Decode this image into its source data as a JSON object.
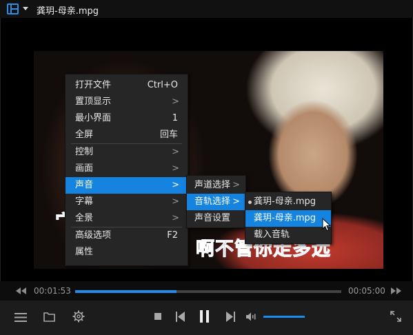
{
  "window": {
    "title": "龚玥-母亲.mpg"
  },
  "video": {
    "subtitle_left": "宀",
    "subtitle": "啊不管你走多远"
  },
  "menu": {
    "items": [
      {
        "label": "打开文件",
        "shortcut": "Ctrl+O",
        "submenu": false
      },
      {
        "label": "置顶显示",
        "shortcut": "",
        "submenu": true
      },
      {
        "label": "最小界面",
        "shortcut": "1",
        "submenu": false
      },
      {
        "label": "全屏",
        "shortcut": "回车",
        "submenu": false
      },
      {
        "label": "控制",
        "shortcut": "",
        "submenu": true
      },
      {
        "label": "画面",
        "shortcut": "",
        "submenu": true
      },
      {
        "label": "声音",
        "shortcut": "",
        "submenu": true
      },
      {
        "label": "字幕",
        "shortcut": "",
        "submenu": true
      },
      {
        "label": "全景",
        "shortcut": "",
        "submenu": true
      },
      {
        "label": "高级选项",
        "shortcut": "F2",
        "submenu": false
      },
      {
        "label": "属性",
        "shortcut": "",
        "submenu": false
      }
    ]
  },
  "sound_menu": {
    "items": [
      {
        "label": "声道选择",
        "submenu": true
      },
      {
        "label": "音轨选择",
        "submenu": true
      },
      {
        "label": "声音设置",
        "submenu": false
      }
    ]
  },
  "track_menu": {
    "items": [
      {
        "label": "龚玥-母亲.mpg",
        "selected": true
      },
      {
        "label": "龚玥-母亲.mpg",
        "selected": false
      },
      {
        "label": "载入音轨",
        "selected": false
      }
    ]
  },
  "playback": {
    "current_time": "00:01:53",
    "total_time": "00:05:00",
    "progress": 0.38,
    "volume": 1.0,
    "state": "playing"
  },
  "icons": {
    "menu": "hamburger-menu-icon",
    "folder": "folder-icon",
    "settings": "gear-icon",
    "stop": "stop-icon",
    "prev": "previous-icon",
    "pause": "pause-icon",
    "next": "next-icon",
    "volume": "volume-icon",
    "fullscreen": "fullscreen-icon"
  },
  "colors": {
    "accent": "#1583e0",
    "menu_bg": "#262626",
    "progress": "#1b8cf0"
  }
}
